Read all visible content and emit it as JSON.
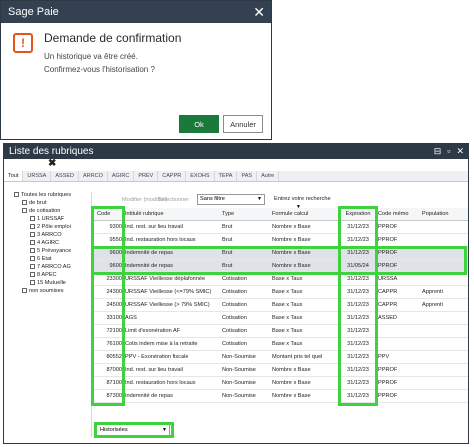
{
  "dialog": {
    "app_title": "Sage Paie",
    "close_glyph": "✕",
    "heading": "Demande de confirmation",
    "message_line1": "Un historique va être créé.",
    "message_line2": "Confirmez-vous l'historisation ?",
    "ok_label": "Ok",
    "cancel_label": "Annuler",
    "icon": "exclamation-icon",
    "icon_glyph": "!",
    "accent_color": "#1a7a3c",
    "warning_color": "#e2551b"
  },
  "window": {
    "title": "Liste des rubriques",
    "controls": [
      "⊟",
      "▫",
      "✕"
    ],
    "toolbar_delete_glyph": "✖",
    "tabs": [
      "Tout",
      "URSSA",
      "ASSED",
      "ARRCO",
      "AGIRC",
      "PREV",
      "CAPPR",
      "EXOHS",
      "TEPA",
      "PAS",
      "Autre"
    ],
    "tree": {
      "root": "Toutes les rubriques",
      "branch_brut": "de brut",
      "branch_cotisation": "de cotisation",
      "cotisation_items": [
        "1 URSSAF",
        "2 Pôle emploi",
        "3 ARRCO",
        "4 AGIRC",
        "5 Prévoyance",
        "6 Etat",
        "7 ARRCO AG",
        "8 APEC",
        "15 Mutuelle"
      ],
      "branch_non_soumises": "non soumises"
    },
    "grid_toolbar": {
      "action1": "Modifier (modifier)",
      "action2": "Sélectionner",
      "filter_value": "Sans filtre",
      "search_label": "Entrez votre recherche"
    },
    "columns": {
      "code": "Code",
      "intitule": "Intitulé rubrique",
      "type": "Type",
      "formule": "Formule calcul",
      "expiration": "Expiration",
      "code_memo": "Code mémo",
      "population": "Population"
    },
    "rows": [
      {
        "code": "9300",
        "intitule": "Ind. rest. sur lieu travail",
        "type": "Brut",
        "formule": "Nombre x Base",
        "expiration": "31/12/23",
        "code_memo": "PPROF",
        "population": ""
      },
      {
        "code": "9550",
        "intitule": "Ind. restauration hors locaux",
        "type": "Brut",
        "formule": "Nombre x Base",
        "expiration": "31/12/23",
        "code_memo": "PPROF",
        "population": ""
      },
      {
        "code": "9600",
        "intitule": "Indemnité de repas",
        "type": "Brut",
        "formule": "Nombre x Base",
        "expiration": "31/12/23",
        "code_memo": "PPROF",
        "population": ""
      },
      {
        "code": "9600",
        "intitule": "Indemnité de repas",
        "type": "Brut",
        "formule": "Nombre x Base",
        "expiration": "31/05/24",
        "code_memo": "PPROF",
        "population": ""
      },
      {
        "code": "23300",
        "intitule": "URSSAF Vieillesse déplafonnée",
        "type": "Cotisation",
        "formule": "Base x Taux",
        "expiration": "31/12/23",
        "code_memo": "URSSA",
        "population": ""
      },
      {
        "code": "24300",
        "intitule": "URSSAF Vieillesse (<=79% SMIC)",
        "type": "Cotisation",
        "formule": "Base x Taux",
        "expiration": "31/12/23",
        "code_memo": "CAPPR",
        "population": "Apprenti"
      },
      {
        "code": "24500",
        "intitule": "URSSAF Vieillesse (> 79% SMIC)",
        "type": "Cotisation",
        "formule": "Base x Taux",
        "expiration": "31/12/23",
        "code_memo": "CAPPR",
        "population": "Apprenti"
      },
      {
        "code": "33100",
        "intitule": "AGS",
        "type": "Cotisation",
        "formule": "Base x Taux",
        "expiration": "31/12/23",
        "code_memo": "ASSED",
        "population": ""
      },
      {
        "code": "72100",
        "intitule": "Limit d'exonération AF",
        "type": "Cotisation",
        "formule": "Base x Taux",
        "expiration": "31/12/23",
        "code_memo": "",
        "population": ""
      },
      {
        "code": "76100",
        "intitule": "Cotis indem mise à la retraite",
        "type": "Cotisation",
        "formule": "Base x Taux",
        "expiration": "31/12/23",
        "code_memo": "",
        "population": ""
      },
      {
        "code": "80552",
        "intitule": "PPV - Exonération fiscale",
        "type": "Non-Soumise",
        "formule": "Montant pris tel quel",
        "expiration": "31/12/23",
        "code_memo": "PPV",
        "population": ""
      },
      {
        "code": "87000",
        "intitule": "Ind. rest. sur lieu travail",
        "type": "Non-Soumise",
        "formule": "Nombre x Base",
        "expiration": "31/12/23",
        "code_memo": "PPROF",
        "population": ""
      },
      {
        "code": "87100",
        "intitule": "Ind. restauration hors locaux",
        "type": "Non-Soumise",
        "formule": "Nombre x Base",
        "expiration": "31/12/23",
        "code_memo": "PPROF",
        "population": ""
      },
      {
        "code": "87300",
        "intitule": "Indemnité de repas",
        "type": "Non-Soumise",
        "formule": "Nombre x Base",
        "expiration": "31/12/23",
        "code_memo": "PPROF",
        "population": ""
      }
    ],
    "status_filter": "Historisées",
    "highlight_color": "#3ed33e"
  }
}
